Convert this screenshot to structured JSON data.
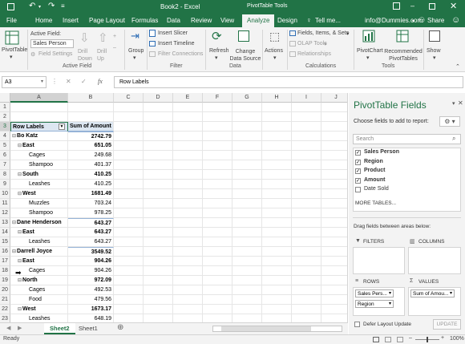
{
  "titlebar": {
    "doc_title": "Book2 - Excel",
    "context_title": "PivotTable Tools",
    "user": "info@Dummies.com",
    "share": "Share"
  },
  "tabs": [
    "File",
    "Home",
    "Insert",
    "Page Layout",
    "Formulas",
    "Data",
    "Review",
    "View",
    "Analyze",
    "Design"
  ],
  "active_tab": "Analyze",
  "tell_me": "Tell me...",
  "ribbon": {
    "pivottable": "PivotTable",
    "active_field_label": "Active Field:",
    "active_field_value": "Sales Person",
    "field_settings": "Field Settings",
    "drill_down": "Drill Down",
    "drill_up": "Drill Up",
    "group": "Group",
    "insert_slicer": "Insert Slicer",
    "insert_timeline": "Insert Timeline",
    "filter_connections": "Filter Connections",
    "refresh": "Refresh",
    "change_data_source": "Change Data Source",
    "actions": "Actions",
    "fields_items_sets": "Fields, Items, & Sets",
    "olap_tools": "OLAP Tools",
    "relationships": "Relationships",
    "pivotchart": "PivotChart",
    "recommended": "Recommended PivotTables",
    "show": "Show",
    "groups": {
      "active_field": "Active Field",
      "filter": "Filter",
      "data": "Data",
      "calculations": "Calculations",
      "tools": "Tools"
    }
  },
  "formula_bar": {
    "name_box": "A3",
    "fx": "fx",
    "content": "Row Labels"
  },
  "columns": [
    "A",
    "B",
    "C",
    "D",
    "E",
    "F",
    "G",
    "H",
    "I",
    "J"
  ],
  "rows": [
    {
      "n": "1",
      "a": "",
      "b": "",
      "indent": 0,
      "bold": false
    },
    {
      "n": "2",
      "a": "",
      "b": "",
      "indent": 0,
      "bold": false
    },
    {
      "n": "3",
      "a": "Row Labels",
      "b": "Sum of Amount",
      "indent": 0,
      "bold": true,
      "header": true
    },
    {
      "n": "4",
      "a": "Bo Katz",
      "b": "2742.79",
      "indent": 0,
      "bold": true,
      "toggle": "⊟"
    },
    {
      "n": "5",
      "a": "East",
      "b": "651.05",
      "indent": 1,
      "bold": true,
      "toggle": "⊟"
    },
    {
      "n": "6",
      "a": "Cages",
      "b": "249.68",
      "indent": 2,
      "bold": false
    },
    {
      "n": "7",
      "a": "Shampoo",
      "b": "401.37",
      "indent": 2,
      "bold": false
    },
    {
      "n": "8",
      "a": "South",
      "b": "410.25",
      "indent": 1,
      "bold": true,
      "toggle": "⊟"
    },
    {
      "n": "9",
      "a": "Leashes",
      "b": "410.25",
      "indent": 2,
      "bold": false
    },
    {
      "n": "10",
      "a": "West",
      "b": "1681.49",
      "indent": 1,
      "bold": true,
      "toggle": "⊟"
    },
    {
      "n": "11",
      "a": "Muzzles",
      "b": "703.24",
      "indent": 2,
      "bold": false
    },
    {
      "n": "12",
      "a": "Shampoo",
      "b": "978.25",
      "indent": 2,
      "bold": false
    },
    {
      "n": "13",
      "a": "Dane Henderson",
      "b": "643.27",
      "indent": 0,
      "bold": true,
      "toggle": "⊟"
    },
    {
      "n": "14",
      "a": "East",
      "b": "643.27",
      "indent": 1,
      "bold": true,
      "toggle": "⊟"
    },
    {
      "n": "15",
      "a": "Leashes",
      "b": "643.27",
      "indent": 2,
      "bold": false
    },
    {
      "n": "16",
      "a": "Darrell Joyce",
      "b": "3549.52",
      "indent": 0,
      "bold": true,
      "toggle": "⊟"
    },
    {
      "n": "17",
      "a": "East",
      "b": "904.26",
      "indent": 1,
      "bold": true,
      "toggle": "⊟"
    },
    {
      "n": "18",
      "a": "Cages",
      "b": "904.26",
      "indent": 2,
      "bold": false
    },
    {
      "n": "19",
      "a": "North",
      "b": "972.09",
      "indent": 1,
      "bold": true,
      "toggle": "⊟"
    },
    {
      "n": "20",
      "a": "Cages",
      "b": "492.53",
      "indent": 2,
      "bold": false
    },
    {
      "n": "21",
      "a": "Food",
      "b": "479.56",
      "indent": 2,
      "bold": false
    },
    {
      "n": "22",
      "a": "West",
      "b": "1673.17",
      "indent": 1,
      "bold": true,
      "toggle": "⊟"
    },
    {
      "n": "23",
      "a": "Leashes",
      "b": "648.19",
      "indent": 2,
      "bold": false
    }
  ],
  "sheets": [
    "Sheet2",
    "Sheet1"
  ],
  "active_sheet": "Sheet2",
  "status": {
    "ready": "Ready",
    "zoom": "100%"
  },
  "pane": {
    "title": "PivotTable Fields",
    "subtitle": "Choose fields to add to report:",
    "search_placeholder": "Search",
    "fields": [
      {
        "label": "Sales Person",
        "checked": true
      },
      {
        "label": "Region",
        "checked": true
      },
      {
        "label": "Product",
        "checked": true
      },
      {
        "label": "Amount",
        "checked": true
      },
      {
        "label": "Date Sold",
        "checked": false
      }
    ],
    "more_tables": "MORE TABLES...",
    "drag_text": "Drag fields between areas below:",
    "filters": "FILTERS",
    "columns": "COLUMNS",
    "rows": "ROWS",
    "values": "VALUES",
    "row_items": [
      "Sales Pers...",
      "Region"
    ],
    "value_items": [
      "Sum of Amou..."
    ],
    "defer": "Defer Layout Update",
    "update": "UPDATE"
  },
  "colors": {
    "excel_green": "#217346",
    "ribbon_bg": "#f3f3f3"
  }
}
